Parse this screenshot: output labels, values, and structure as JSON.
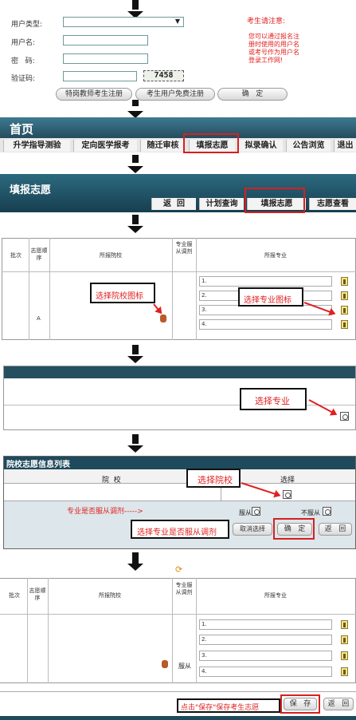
{
  "login": {
    "user_type_label": "用户类型:",
    "username_label": "用户名:",
    "password_label": "密   码:",
    "captcha_label": "验证码:",
    "captcha_value": "7458",
    "register_button_label": "特岗教师考生注册",
    "free_register_button_label": "考生用户免费注册",
    "confirm_button_label": "确   定",
    "notice_title": "考生请注意:",
    "notice_body": "您可以通过报名注册时使用的用户名或考号作为用户名登录工作网!"
  },
  "home_nav": {
    "title": "首页",
    "tabs": [
      "升学指导测验",
      "定向医学报考",
      "随迁审核",
      "填报志愿",
      "拟录确认",
      "公告浏览",
      "退出"
    ]
  },
  "fill_nav": {
    "title": "填报志愿",
    "tabs": [
      "返  回",
      "计划查询",
      "填报志愿",
      "志愿查看"
    ]
  },
  "table": {
    "headers": [
      "批次",
      "志愿顺序",
      "所报院校",
      "专业服从调剂",
      "所报专业"
    ],
    "rows": [
      "1.",
      "2.",
      "3.",
      "4."
    ],
    "order_letter": "A",
    "select_school_note": "选择院校图标",
    "select_major_note": "选择专业图标"
  },
  "major_panel": {
    "note": "选择专业"
  },
  "school_list": {
    "title": "院校志愿信息列表",
    "school_header": "院  校",
    "select_header": "选择",
    "select_school_note": "选择院校",
    "obey_question": "专业是否服从调剂----->",
    "obey_label": "服从",
    "not_obey_label": "不服从",
    "obey_choice_note": "选择专业是否服从调剂",
    "cancel_button_label": "取消选择",
    "confirm_button_label": "确   定",
    "back_button_label": "返   回"
  },
  "final_table": {
    "headers": [
      "批次",
      "志愿顺序",
      "所报院校",
      "专业服从调剂",
      "所报专业"
    ],
    "rows": [
      "1.",
      "2.",
      "3.",
      "4."
    ],
    "obey_value": "服从",
    "save_note": "点击\"保存\"保存考生志愿",
    "save_button_label": "保   存",
    "back_button_label": "返   回"
  }
}
